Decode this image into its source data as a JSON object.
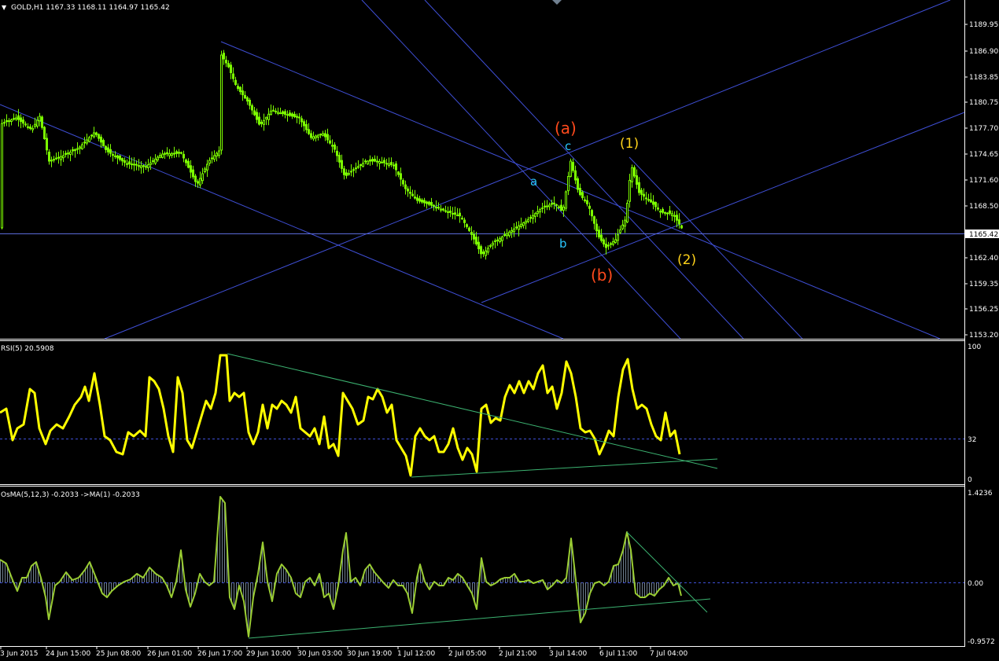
{
  "main": {
    "header_arrow": "▼",
    "header": "GOLD,H1  1167.33 1168.11 1164.97 1165.42",
    "current_price": "1165.42",
    "price_ticks": [
      "1189.95",
      "1186.90",
      "1183.85",
      "1180.75",
      "1177.70",
      "1174.65",
      "1171.60",
      "1168.50",
      "1165.42",
      "1162.40",
      "1159.35",
      "1156.25",
      "1153.20"
    ],
    "wave_labels": [
      {
        "text": "(a)",
        "color": "#ff4a1c"
      },
      {
        "text": "c",
        "color": "#29c6ff"
      },
      {
        "text": "(1)",
        "color": "#ffd21a"
      },
      {
        "text": "a",
        "color": "#29c6ff"
      },
      {
        "text": "b",
        "color": "#29c6ff"
      },
      {
        "text": "(b)",
        "color": "#ff4a1c"
      },
      {
        "text": "(2)",
        "color": "#ffd21a"
      }
    ]
  },
  "rsi": {
    "header": "RSI(5) 20.5908",
    "ticks": [
      "100",
      "32",
      "0"
    ]
  },
  "osma": {
    "header": "OsMA(5,12,3) -0.2033  ->MA(1) -0.2033",
    "ticks": [
      "1.4236",
      "0.00",
      "-0.9572"
    ]
  },
  "time_axis": [
    "3 Jun 2015",
    "24 Jun 15:00",
    "25 Jun 08:00",
    "26 Jun 01:00",
    "26 Jun 17:00",
    "29 Jun 10:00",
    "30 Jun 03:00",
    "30 Jun 19:00",
    "1 Jul 12:00",
    "2 Jul 05:00",
    "2 Jul 21:00",
    "3 Jul 14:00",
    "6 Jul 11:00",
    "7 Jul 04:00"
  ],
  "colors": {
    "background": "#000000",
    "candles": "#7cfc00",
    "trendlines": "#3f4fd6",
    "rsi_line": "#ffff00",
    "osma_line": "#9acd32",
    "osma_hist": "#708090",
    "indicator_trend": "#3cb371",
    "axis_text": "#ffffff"
  }
}
